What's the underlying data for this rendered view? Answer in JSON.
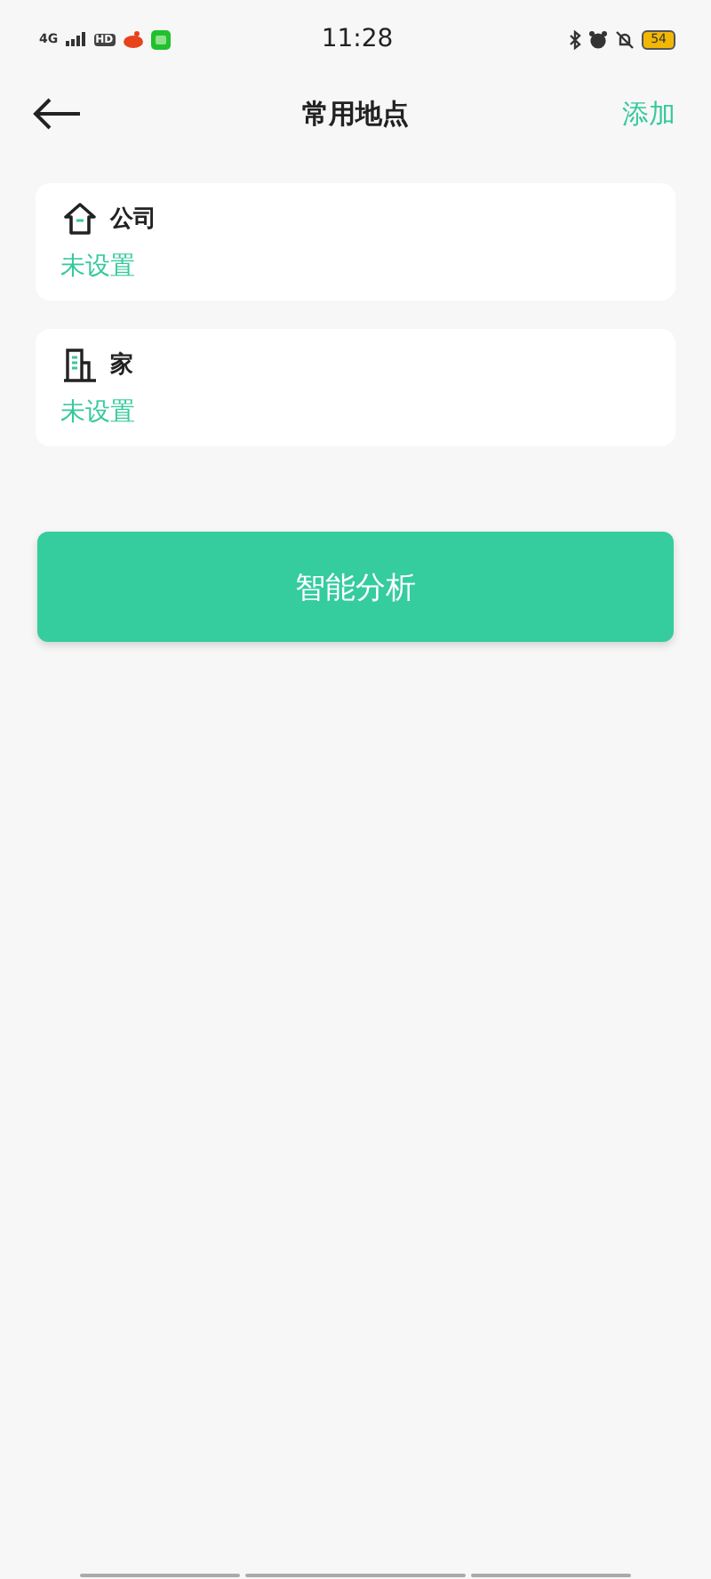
{
  "status_bar": {
    "network": "4G",
    "hd": "HD",
    "time": "11:28",
    "battery": "54"
  },
  "header": {
    "title": "常用地点",
    "action": "添加"
  },
  "places": [
    {
      "kind": "house",
      "name": "公司",
      "value": "未设置"
    },
    {
      "kind": "building",
      "name": "家",
      "value": "未设置"
    }
  ],
  "analyze_button": "智能分析"
}
